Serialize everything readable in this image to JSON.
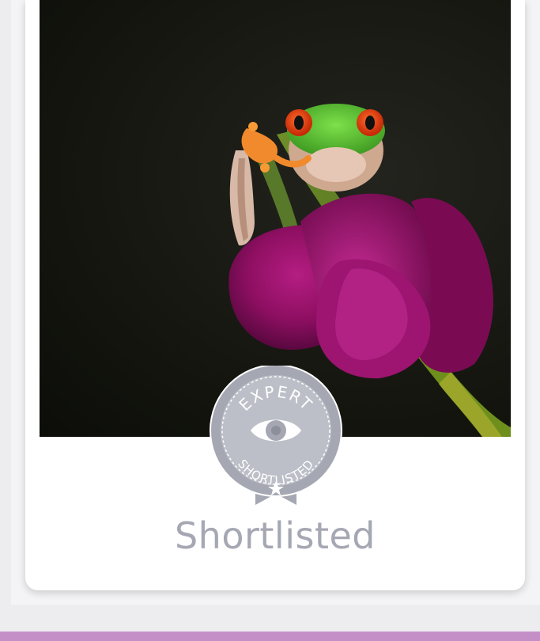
{
  "card": {
    "photo": {
      "subject": "red-eyed-tree-frog-on-magenta-tulip",
      "background_color": "#15160f"
    },
    "badge": {
      "top_text": "EXPERT",
      "bottom_text": "SHORTLISTED",
      "icon": "eye-icon",
      "color": "#a5a7b3"
    },
    "status_label": "Shortlisted"
  },
  "colors": {
    "accent_bar": "#c48fc6",
    "status_text": "#a5a7b3"
  }
}
